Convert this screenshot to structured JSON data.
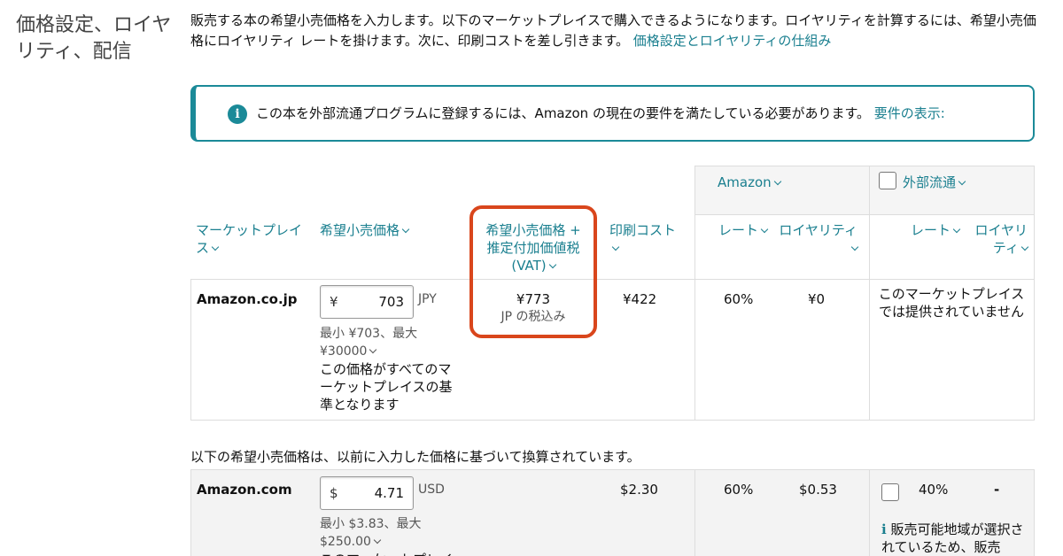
{
  "section": {
    "title": "価格設定、ロイヤリティ、配信"
  },
  "intro": {
    "text": "販売する本の希望小売価格を入力します。以下のマーケットプレイスで購入できるようになります。ロイヤリティを計算するには、希望小売価格にロイヤリティ レートを掛けます。次に、印刷コストを差し引きます。",
    "link": "価格設定とロイヤリティの仕組み"
  },
  "notice": {
    "message": "この本を外部流通プログラムに登録するには、Amazon の現在の要件を満たしている必要があります。",
    "link": "要件の表示:"
  },
  "table": {
    "headers": {
      "marketplace": "マーケットプレイス",
      "list_price": "希望小売価格",
      "vat_price": "希望小売価格 + 推定付加価値税 (VAT)",
      "print_cost": "印刷コスト",
      "amazon_group": "Amazon",
      "external_group": "外部流通",
      "rate": "レート",
      "royalty": "ロイヤリティ"
    },
    "rows": [
      {
        "marketplace": "Amazon.co.jp",
        "currency_symbol": "¥",
        "price": "703",
        "currency": "JPY",
        "range": "最小 ¥703、最大 ¥30000",
        "note": "この価格がすべてのマーケットプレイスの基準となります",
        "vat_price": "¥773",
        "vat_note": "JP の税込み",
        "print_cost": "¥422",
        "amazon_rate": "60%",
        "amazon_royalty": "¥0",
        "external_note": "このマーケットプレイスでは提供されていません"
      },
      {
        "marketplace": "Amazon.com",
        "currency_symbol": "$",
        "price": "4.71",
        "currency": "USD",
        "range": "最小 $3.83、最大 $250.00",
        "note_partial": "このマーケットプレイスの基準となります",
        "print_cost": "$2.30",
        "amazon_rate": "60%",
        "amazon_royalty": "$0.53",
        "external_rate": "40%",
        "external_royalty": "-",
        "external_note": "販売可能地域が選択されているため、販売"
      }
    ],
    "converted_note": "以下の希望小売価格は、以前に入力した価格に基づいて換算されています。"
  },
  "colors": {
    "link": "#1a7f8f",
    "highlight": "#d9461c",
    "info": "#1b8a98"
  }
}
